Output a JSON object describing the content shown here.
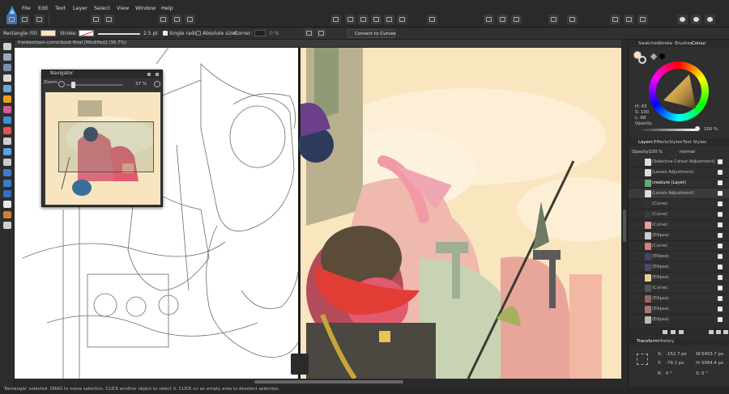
{
  "app": {
    "name": "Affinity Designer"
  },
  "menu": [
    "File",
    "Edit",
    "Text",
    "Layer",
    "Select",
    "View",
    "Window",
    "Help"
  ],
  "context_toolbar": {
    "shape": "Rectangle:",
    "fill_label": "Fill:",
    "stroke_label": "Stroke:",
    "stroke_width": "2.5 pt",
    "single_radius": "Single radius",
    "absolute_sizes": "Absolute sizes",
    "corner_label": "Corner:",
    "corner_value": "0 %",
    "convert_label": "Convert to Curves"
  },
  "document": {
    "tab_title": "frankentoon-comicbook-final [Modified] (36.7%)"
  },
  "navigator": {
    "title": "Navigator",
    "zoom_label": "Zoom:",
    "zoom_value": "37 %"
  },
  "panels": {
    "top_tabs": [
      "Swatches",
      "Stroke",
      "Brushes",
      "Colour"
    ],
    "colour": {
      "h": "H: 43",
      "s": "S: 100",
      "l": "L: 88",
      "opacity_label": "Opacity",
      "opacity_value": "100 %"
    },
    "layer_tabs": [
      "Layers",
      "Effects",
      "Styles",
      "Text Styles"
    ],
    "layers_opacity_label": "Opacity:",
    "layers_opacity_value": "100 %",
    "blend_mode": "normal",
    "layers": [
      {
        "name": "(Selective Colour Adjustment)",
        "color": "#dddddd"
      },
      {
        "name": "(Levels Adjustment)",
        "color": "#dddddd"
      },
      {
        "name": "creature (Layer)",
        "color": "#66aa77"
      },
      {
        "name": "(Levels Adjustment)",
        "color": "#dddddd"
      },
      {
        "name": "(Curve)",
        "color": "#333333"
      },
      {
        "name": "(Curve)",
        "color": "#3a3a3a"
      },
      {
        "name": "(Curve)",
        "color": "#e0a0a0"
      },
      {
        "name": "(Ellipse)",
        "color": "#cccccc"
      },
      {
        "name": "(Curve)",
        "color": "#d08080"
      },
      {
        "name": "(Ellipse)",
        "color": "#444466"
      },
      {
        "name": "(Ellipse)",
        "color": "#4a4a6a"
      },
      {
        "name": "(Ellipse)",
        "color": "#e8d090"
      },
      {
        "name": "(Curve)",
        "color": "#555555"
      },
      {
        "name": "(Ellipse)",
        "color": "#996666"
      },
      {
        "name": "(Ellipse)",
        "color": "#aa7777"
      },
      {
        "name": "(Ellipse)",
        "color": "#bbbbbb"
      }
    ],
    "bottom_tabs": [
      "Transform",
      "History"
    ],
    "transform": {
      "x": "-152.7 px",
      "y": "-79.1 px",
      "w": "5453.7 px",
      "h": "5084.4 px",
      "r": "0 °",
      "s": "0 °"
    }
  },
  "status": {
    "text": "'Rectangle' selected. DRAG to move selection. CLICK another object to select it. CLICK on an empty area to deselect selection."
  },
  "colors": {
    "accent": "#4b6f9c",
    "fill_swatch": "#fbe4c3",
    "bg": "#f9e5be"
  }
}
